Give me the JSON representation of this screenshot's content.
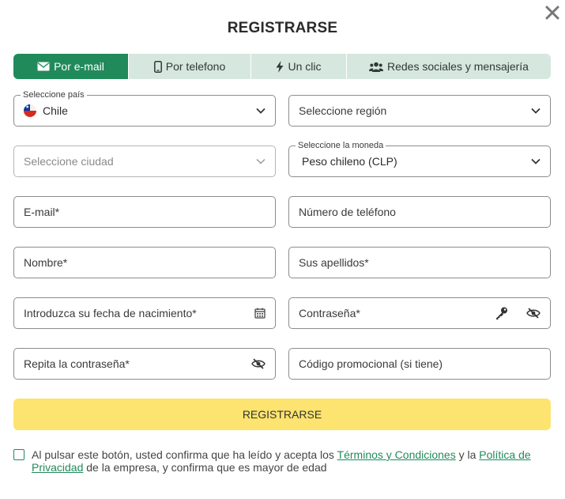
{
  "title": "REGISTRARSE",
  "tabs": [
    {
      "label": "Por e-mail",
      "icon": "envelope-icon",
      "active": true
    },
    {
      "label": "Por telefono",
      "icon": "phone-icon",
      "active": false
    },
    {
      "label": "Un clic",
      "icon": "lightning-icon",
      "active": false
    },
    {
      "label": "Redes sociales y mensajería",
      "icon": "users-icon",
      "active": false
    }
  ],
  "form": {
    "country": {
      "legend": "Seleccione país",
      "value": "Chile"
    },
    "region": {
      "placeholder": "Seleccione región"
    },
    "city": {
      "placeholder": "Seleccione ciudad"
    },
    "currency": {
      "legend": "Seleccione la moneda",
      "value": "Peso chileno (CLP)"
    },
    "email": {
      "placeholder": "E-mail*"
    },
    "phone": {
      "placeholder": "Número de teléfono"
    },
    "first_name": {
      "placeholder": "Nombre*"
    },
    "last_name": {
      "placeholder": "Sus apellidos*"
    },
    "birthdate": {
      "placeholder": "Introduzca su fecha de nacimiento*"
    },
    "password": {
      "placeholder": "Contraseña*"
    },
    "password_repeat": {
      "placeholder": "Repita la contraseña*"
    },
    "promo_code": {
      "placeholder": "Código promocional (si tiene)"
    }
  },
  "submit_label": "REGISTRARSE",
  "consent": {
    "prefix": "Al pulsar este botón, usted confirma que ha leído y acepta los ",
    "terms_link": "Términos y Condiciones",
    "middle": " y la ",
    "privacy_link": "Política de Privacidad",
    "suffix": " de la empresa, y confirma que es mayor de edad"
  },
  "colors": {
    "accent": "#218a5b",
    "tab_bg": "#d6e7df",
    "submit_bg": "#fde36f"
  }
}
